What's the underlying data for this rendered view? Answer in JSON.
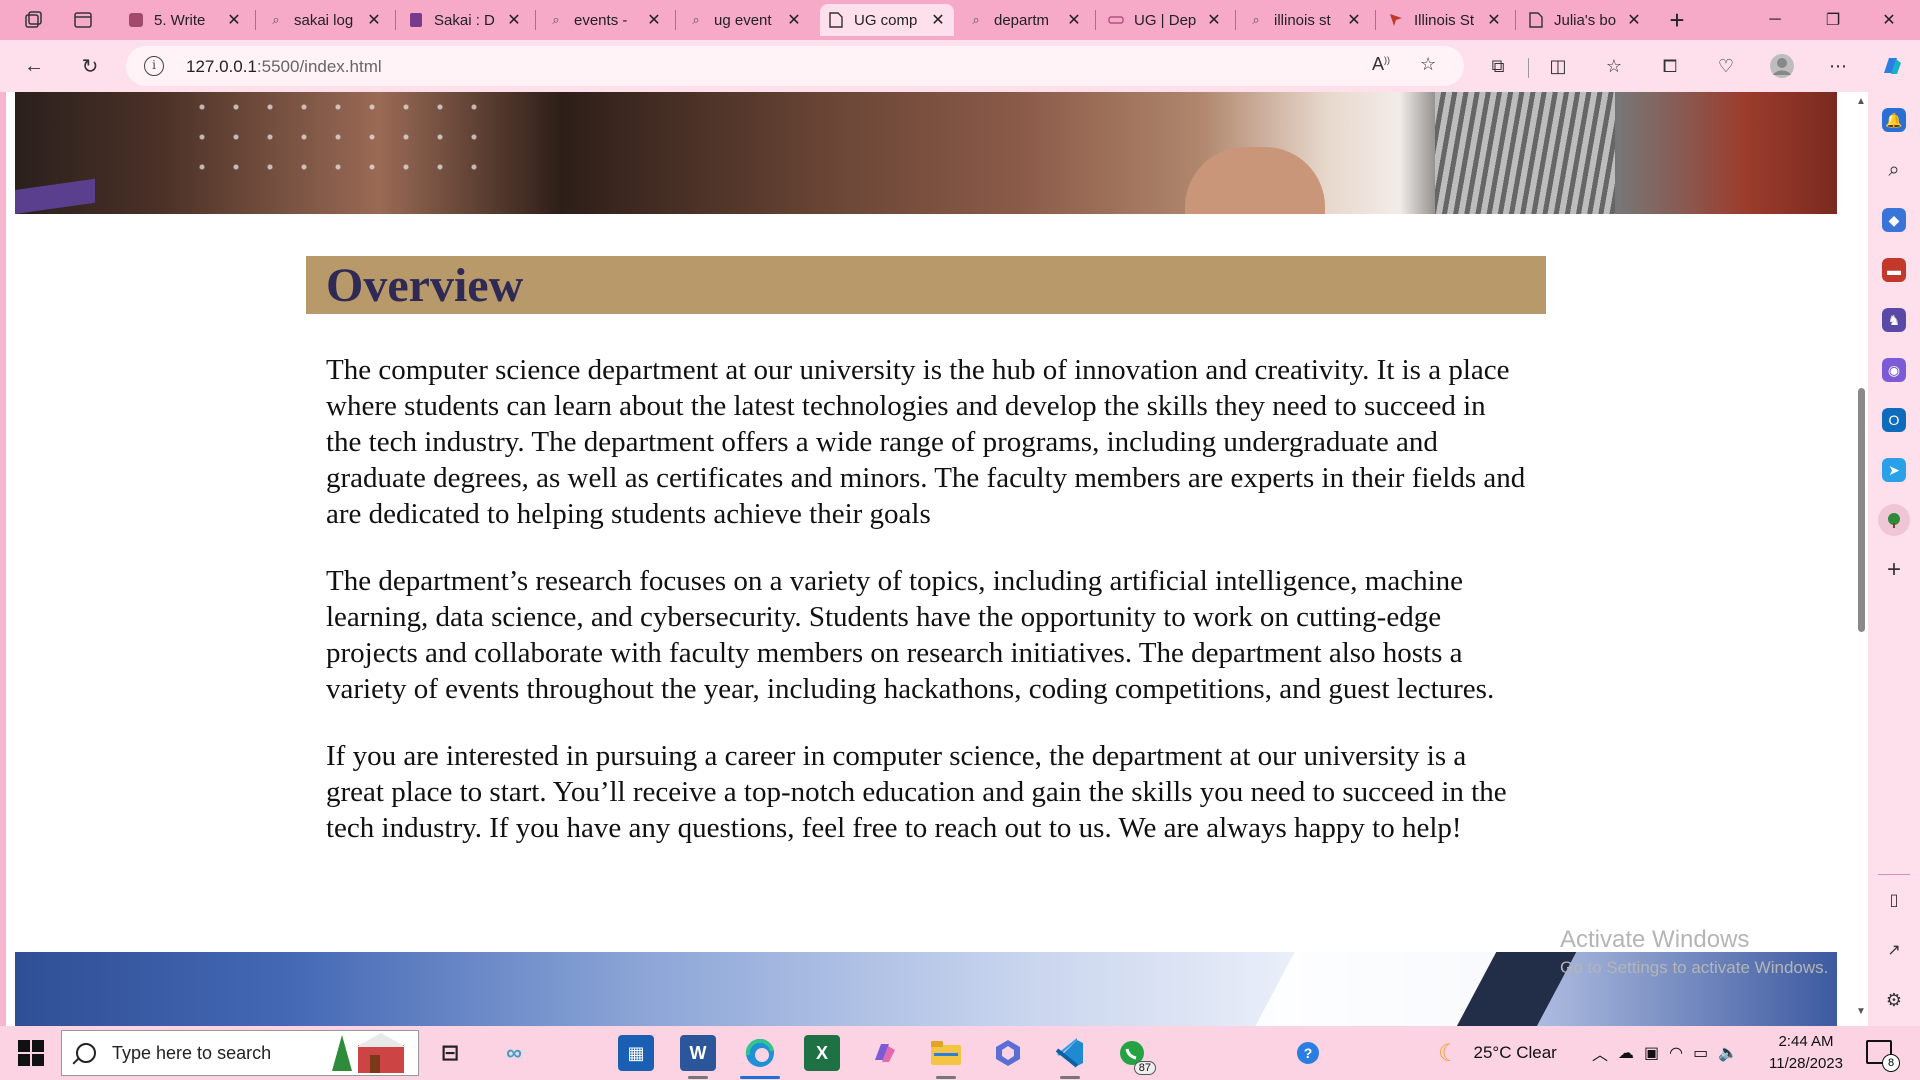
{
  "browser": {
    "tabs": [
      {
        "title": "5. Write",
        "icon": "web-page-icon"
      },
      {
        "title": "sakai log",
        "icon": "search-icon"
      },
      {
        "title": "Sakai : D",
        "icon": "sakai-icon"
      },
      {
        "title": "events -",
        "icon": "search-icon"
      },
      {
        "title": "ug event",
        "icon": "search-icon"
      },
      {
        "title": "UG comp",
        "icon": "document-icon",
        "active": true
      },
      {
        "title": "departm",
        "icon": "search-icon"
      },
      {
        "title": "UG | Dep",
        "icon": "web-page-icon"
      },
      {
        "title": "illinois st",
        "icon": "search-icon"
      },
      {
        "title": "Illinois St",
        "icon": "bookmark-icon"
      },
      {
        "title": "Julia's bo",
        "icon": "document-icon"
      }
    ],
    "url_host": "127.0.0.1",
    "url_rest": ":5500/index.html",
    "accent": "#f7a9c8"
  },
  "page": {
    "heading": "Overview",
    "paragraphs": [
      "The computer science department at our university is the hub of innovation and creativity. It is a place where students can learn about the latest technologies and develop the skills they need to succeed in the tech industry. The department offers a wide range of programs, including undergraduate and graduate degrees, as well as certificates and minors. The faculty members are experts in their fields and are dedicated to helping students achieve their goals",
      "The department’s research focuses on a variety of topics, including artificial intelligence, machine learning, data science, and cybersecurity. Students have the opportunity to work on cutting-edge projects and collaborate with faculty members on research initiatives. The department also hosts a variety of events throughout the year, including hackathons, coding competitions, and guest lectures.",
      "If you are interested in pursuing a career in computer science, the department at our university is a great place to start. You’ll receive a top-notch education and gain the skills you need to succeed in the tech industry. If you have any questions, feel free to reach out to us. We are always happy to help!"
    ],
    "heading_bg": "#b8996a",
    "heading_color": "#2f2a55"
  },
  "watermark": {
    "line1": "Activate Windows",
    "line2": "Go to Settings to activate Windows."
  },
  "taskbar": {
    "search_placeholder": "Type here to search",
    "whatsapp_badge": "87",
    "weather": "25°C  Clear",
    "time": "2:44 AM",
    "date": "11/28/2023",
    "notification_count": "8"
  }
}
